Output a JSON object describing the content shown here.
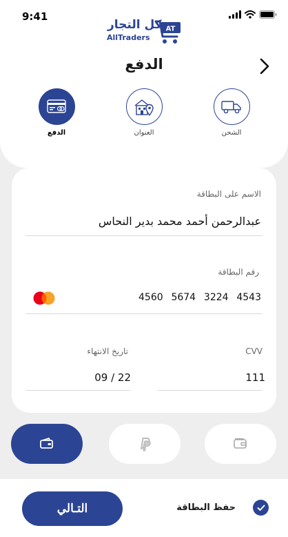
{
  "status_bar": {
    "time": "9:41"
  },
  "logo": {
    "text_ar": "كل التجار",
    "text_en": "AllTraders",
    "badge": "AT"
  },
  "header": {
    "title": "الدفع"
  },
  "steps": [
    {
      "label": "الشحن",
      "icon": "truck-icon",
      "active": false
    },
    {
      "label": "العنوان",
      "icon": "location-building-icon",
      "active": false
    },
    {
      "label": "الدفع",
      "icon": "card-icon",
      "active": true
    }
  ],
  "card_form": {
    "name_label": "الاسم على البطاقة",
    "name_value": "عبدالرحمن أحمد محمد بدير النحاس",
    "number_label": "رقم البطاقة",
    "number_groups": [
      "4560",
      "5674",
      "3224",
      "4543"
    ],
    "card_brand_icon": "mastercard-icon",
    "expiry_label": "تاريخ الانتهاء",
    "expiry_value": "09 / 22",
    "cvv_label": "CVV",
    "cvv_value": "111"
  },
  "payment_methods": [
    {
      "icon": "wallet-card-icon",
      "active": true
    },
    {
      "icon": "paypal-icon",
      "active": false
    },
    {
      "icon": "wallet-icon",
      "active": false
    }
  ],
  "footer": {
    "next_label": "التـالي",
    "save_card_label": "حفظ البطاقة",
    "save_card_checked": true
  },
  "colors": {
    "primary": "#2b4494",
    "background": "#eeeeee",
    "mastercard_red": "#eb001b",
    "mastercard_yellow": "#f79e1b"
  }
}
